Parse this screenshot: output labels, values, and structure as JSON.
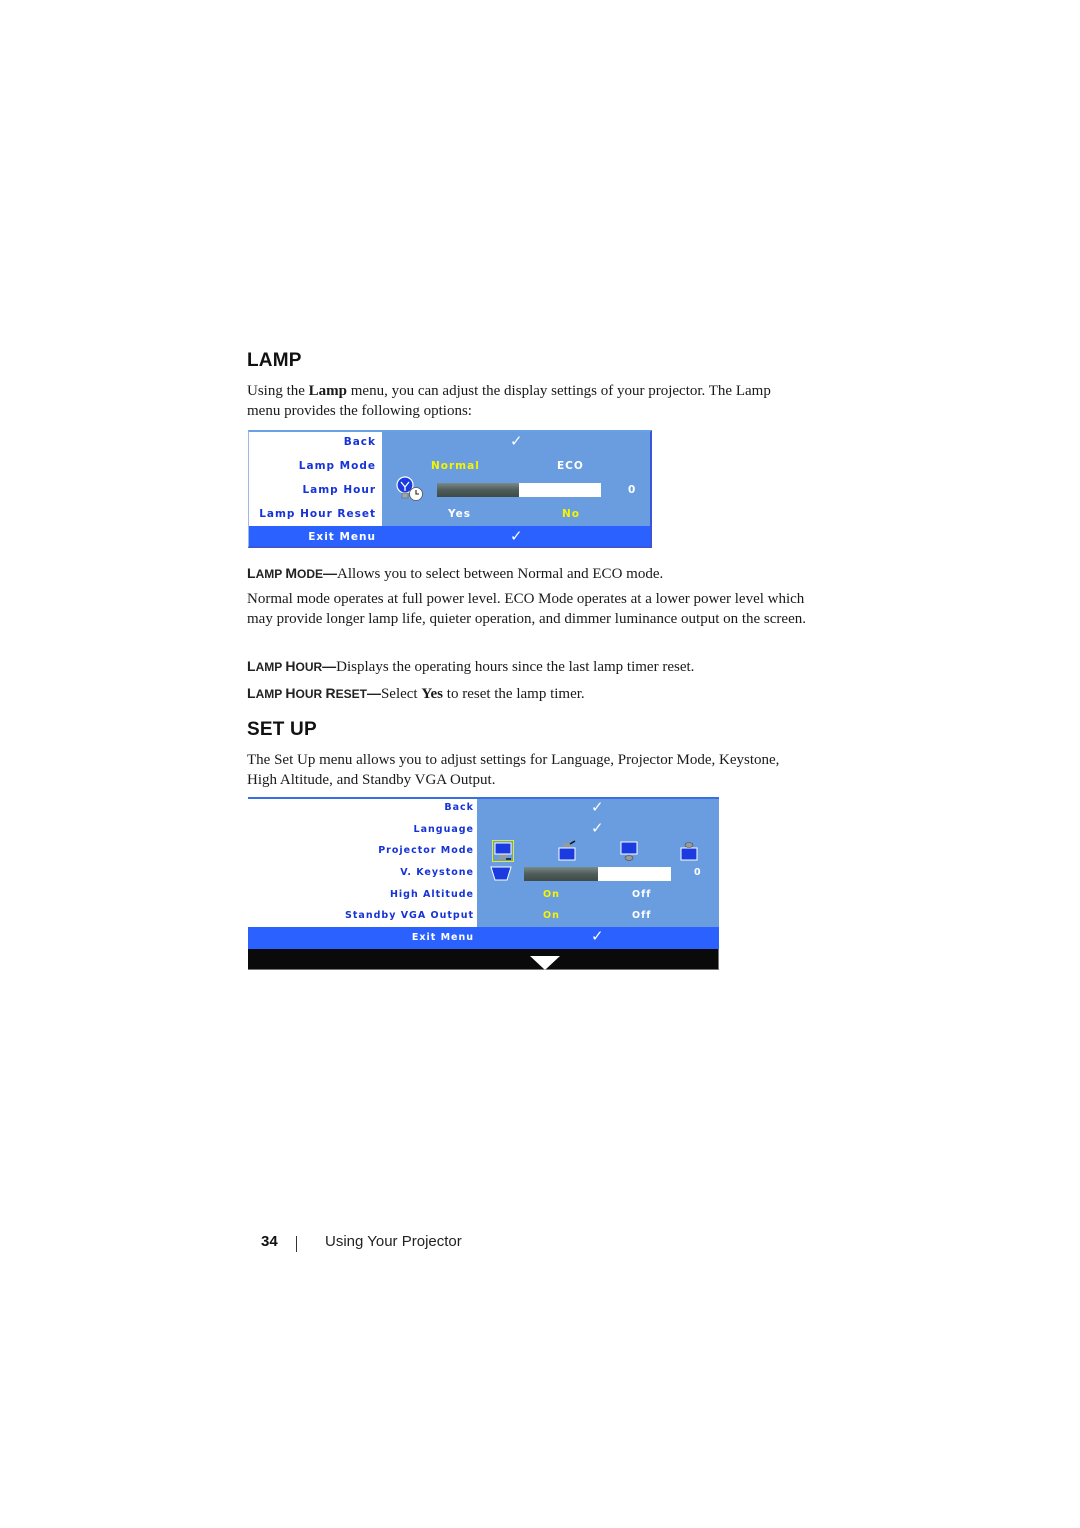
{
  "lamp_section": {
    "heading": "LAMP",
    "intro_pre": "Using the ",
    "intro_bold": "Lamp",
    "intro_post": " menu, you can adjust the display settings of your projector. The Lamp menu provides the following options:",
    "osd": {
      "rows": [
        {
          "label": "Back"
        },
        {
          "label": "Lamp Mode",
          "options": [
            "Normal",
            "ECO"
          ],
          "selected": "Normal"
        },
        {
          "label": "Lamp Hour",
          "value": "0",
          "progress_fraction": 0.5
        },
        {
          "label": "Lamp Hour Reset",
          "options": [
            "Yes",
            "No"
          ],
          "selected": "No"
        }
      ],
      "exit_label": "Exit Menu",
      "check_glyph": "✓",
      "icon": "lamp-clock-icon"
    },
    "definitions": [
      {
        "term_first_cap": "L",
        "term_rest": "AMP ",
        "term2_first_cap": "M",
        "term2_rest": "ODE",
        "dash": "—",
        "text": "Allows you to select between Normal and ECO mode."
      },
      {
        "term_first_cap": "L",
        "term_rest": "AMP ",
        "term2_first_cap": "H",
        "term2_rest": "OUR",
        "dash": "—",
        "text": "Displays the operating hours since the last lamp timer reset."
      },
      {
        "term_first_cap": "L",
        "term_rest": "AMP ",
        "term2_first_cap": "H",
        "term2_rest": "OUR ",
        "term3_first_cap": "R",
        "term3_rest": "ESET",
        "dash": "—",
        "text_pre": "Select ",
        "text_bold": "Yes",
        "text_post": " to reset the lamp timer."
      }
    ],
    "mode_paragraph": "Normal mode operates at full power level. ECO Mode operates at a lower power level which may provide longer lamp life, quieter operation, and dimmer luminance output on the screen."
  },
  "setup_section": {
    "heading": "SET UP",
    "intro": "The Set Up menu allows you to adjust settings for Language, Projector Mode, Keystone, High Altitude, and Standby VGA Output.",
    "osd": {
      "rows": [
        {
          "label": "Back"
        },
        {
          "label": "Language"
        },
        {
          "label": "Projector Mode",
          "icons": [
            "front-projection-desktop-icon",
            "rear-projection-ceiling-icon",
            "rear-projection-desktop-icon",
            "front-projection-ceiling-icon"
          ],
          "selected_index": 0
        },
        {
          "label": "V. Keystone",
          "value": "0",
          "progress_fraction": 0.5,
          "icon": "keystone-icon"
        },
        {
          "label": "High Altitude",
          "options": [
            "On",
            "Off"
          ],
          "selected": "On"
        },
        {
          "label": "Standby VGA Output",
          "options": [
            "On",
            "Off"
          ],
          "selected": "On"
        }
      ],
      "exit_label": "Exit Menu",
      "check_glyph": "✓",
      "scroll_indicator": "down-triangle-icon"
    }
  },
  "footer": {
    "page_number": "34",
    "title": "Using Your Projector"
  },
  "colors": {
    "osd_panel_blue": "#6a9de0",
    "osd_exit_blue": "#2b62ff",
    "osd_label_blue": "#1633d6",
    "osd_selected_yellow": "#f5f500"
  }
}
